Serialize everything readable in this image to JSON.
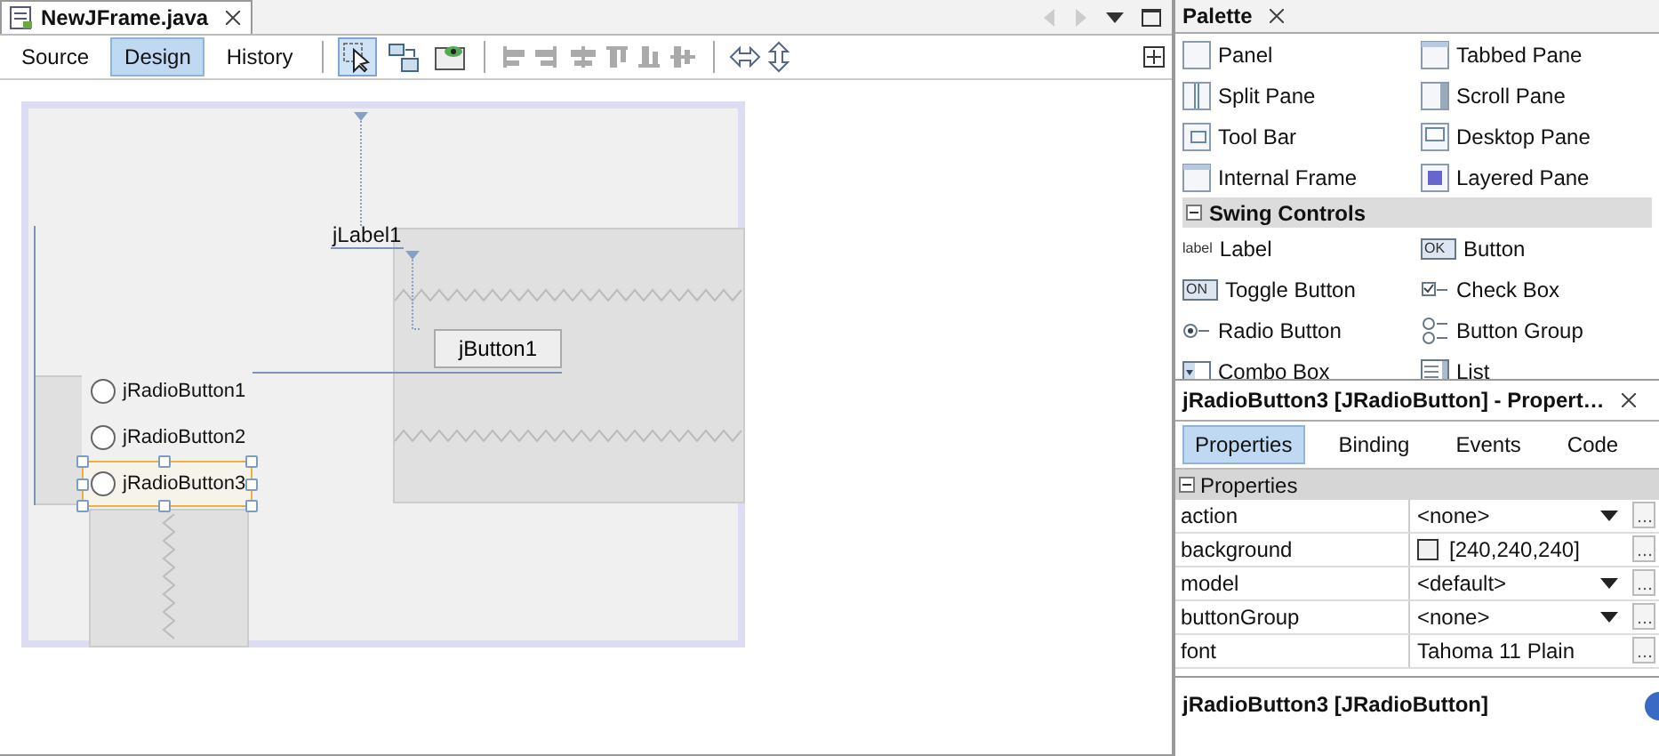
{
  "editor_tab": {
    "title": "NewJFrame.java"
  },
  "view_tabs": [
    {
      "label": "Source",
      "selected": false
    },
    {
      "label": "Design",
      "selected": true
    },
    {
      "label": "History",
      "selected": false
    }
  ],
  "tools": [
    {
      "kind": "select",
      "selected": true
    },
    {
      "kind": "connect",
      "selected": false
    },
    {
      "kind": "preview",
      "selected": false
    }
  ],
  "canvas": {
    "label": "jLabel1",
    "button": "jButton1",
    "radios": [
      {
        "label": "jRadioButton1",
        "checked": false,
        "selected": false
      },
      {
        "label": "jRadioButton2",
        "checked": false,
        "selected": false
      },
      {
        "label": "jRadioButton3",
        "checked": false,
        "selected": true
      }
    ]
  },
  "palette": {
    "title": "Palette",
    "items": [
      {
        "label": "Panel",
        "kind": "box"
      },
      {
        "label": "Tabbed Pane",
        "kind": "window"
      },
      {
        "label": "Split Pane",
        "kind": "split"
      },
      {
        "label": "Scroll Pane",
        "kind": "scroll"
      },
      {
        "label": "Tool Bar",
        "kind": "toolbar"
      },
      {
        "label": "Desktop Pane",
        "kind": "desktop"
      },
      {
        "label": "Internal Frame",
        "kind": "window"
      },
      {
        "label": "Layered Pane",
        "kind": "layered"
      }
    ],
    "section": {
      "label": "Swing Controls",
      "expanded": true
    },
    "controls": [
      {
        "label": "Label",
        "kind": "text",
        "glyph": "label"
      },
      {
        "label": "Button",
        "kind": "text",
        "glyph": "OK"
      },
      {
        "label": "Toggle Button",
        "kind": "text",
        "glyph": "ON"
      },
      {
        "label": "Check Box",
        "kind": "check"
      },
      {
        "label": "Radio Button",
        "kind": "radio"
      },
      {
        "label": "Button Group",
        "kind": "group"
      },
      {
        "label": "Combo Box",
        "kind": "combo"
      },
      {
        "label": "List",
        "kind": "list"
      }
    ]
  },
  "properties": {
    "title": "jRadioButton3 [JRadioButton] - Propert…",
    "tabs": [
      {
        "label": "Properties",
        "selected": true
      },
      {
        "label": "Binding",
        "selected": false
      },
      {
        "label": "Events",
        "selected": false
      },
      {
        "label": "Code",
        "selected": false
      }
    ],
    "section": {
      "label": "Properties",
      "expanded": true
    },
    "rows": [
      {
        "name": "action",
        "value": "<none>",
        "kind": "dropdown"
      },
      {
        "name": "background",
        "value": "[240,240,240]",
        "kind": "color",
        "color": "#f0f0f0"
      },
      {
        "name": "model",
        "value": "<default>",
        "kind": "dropdown"
      },
      {
        "name": "buttonGroup",
        "value": "<none>",
        "kind": "dropdown"
      },
      {
        "name": "font",
        "value": "Tahoma 11 Plain",
        "kind": "text"
      }
    ],
    "description": "jRadioButton3 [JRadioButton]"
  }
}
